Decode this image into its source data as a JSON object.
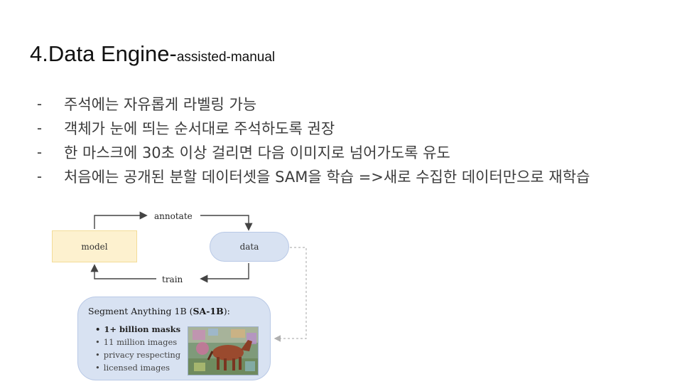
{
  "slide": {
    "title_main": "4.Data Engine-",
    "title_sub": "assisted-manual",
    "bullet_marker": "-",
    "bullets": [
      "주석에는 자유롭게 라벨링 가능",
      "객체가 눈에 띄는 순서대로 주석하도록 권장",
      "한 마스크에 30초 이상 걸리면 다음 이미지로 넘어가도록 유도",
      "처음에는 공개된 분할 데이터셋을 SAM을 학습 =>새로 수집한 데이터만으로 재학습"
    ]
  },
  "diagram": {
    "model_label": "model",
    "data_label": "data",
    "annotate_label": "annotate",
    "train_label": "train",
    "dataset_title_prefix": "Segment Anything 1B (",
    "dataset_title_bold": "SA-1B",
    "dataset_title_suffix": "):",
    "dataset_items": [
      "1+ billion masks",
      "11 million images",
      "privacy respecting",
      "licensed images"
    ],
    "colors": {
      "model_fill": "#fdf1cf",
      "data_fill": "#d8e2f2",
      "arrow": "#444444",
      "dashed": "#b5b5b5"
    }
  }
}
